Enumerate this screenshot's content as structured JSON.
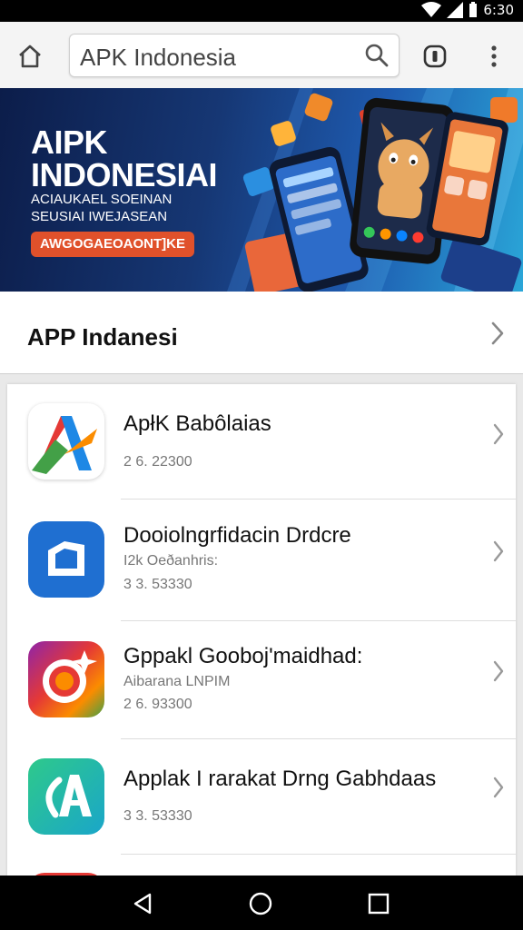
{
  "status_bar": {
    "time": "6:30"
  },
  "toolbar": {
    "search_text": "APK Indonesia"
  },
  "banner": {
    "title_line1": "AIPK",
    "title_line2": "INDONESIAI",
    "subtitle_line1": "ACIAUKAEL SOEINAN",
    "subtitle_line2": "SEUSIAI IWEJASEAN",
    "cta_label": "AWGOGAEOAONT]KE"
  },
  "section": {
    "label": "APP Indanesi"
  },
  "apps": [
    {
      "name": "ApłK Babôlaias",
      "line2": "",
      "line3": "2 6. 22300",
      "icon": "apk-a-logo-icon"
    },
    {
      "name": "Dooiolngrfidacin Drdcre",
      "line2": "I2k Oeðanhris:",
      "line3": "3 3. 53330",
      "icon": "blue-box-icon"
    },
    {
      "name": "Gppakl Gooboj'maidhad:",
      "line2": "Aibarana LNPIM",
      "line3": "2 6. 93300",
      "icon": "camera-lens-icon"
    },
    {
      "name": "Applak I rarakat Drng Gabhdaas",
      "line2": "",
      "line3": "3 3. 53330",
      "icon": "green-a-icon"
    }
  ],
  "colors": {
    "banner_cta": "#e0512b",
    "banner_bg": "#163774"
  }
}
